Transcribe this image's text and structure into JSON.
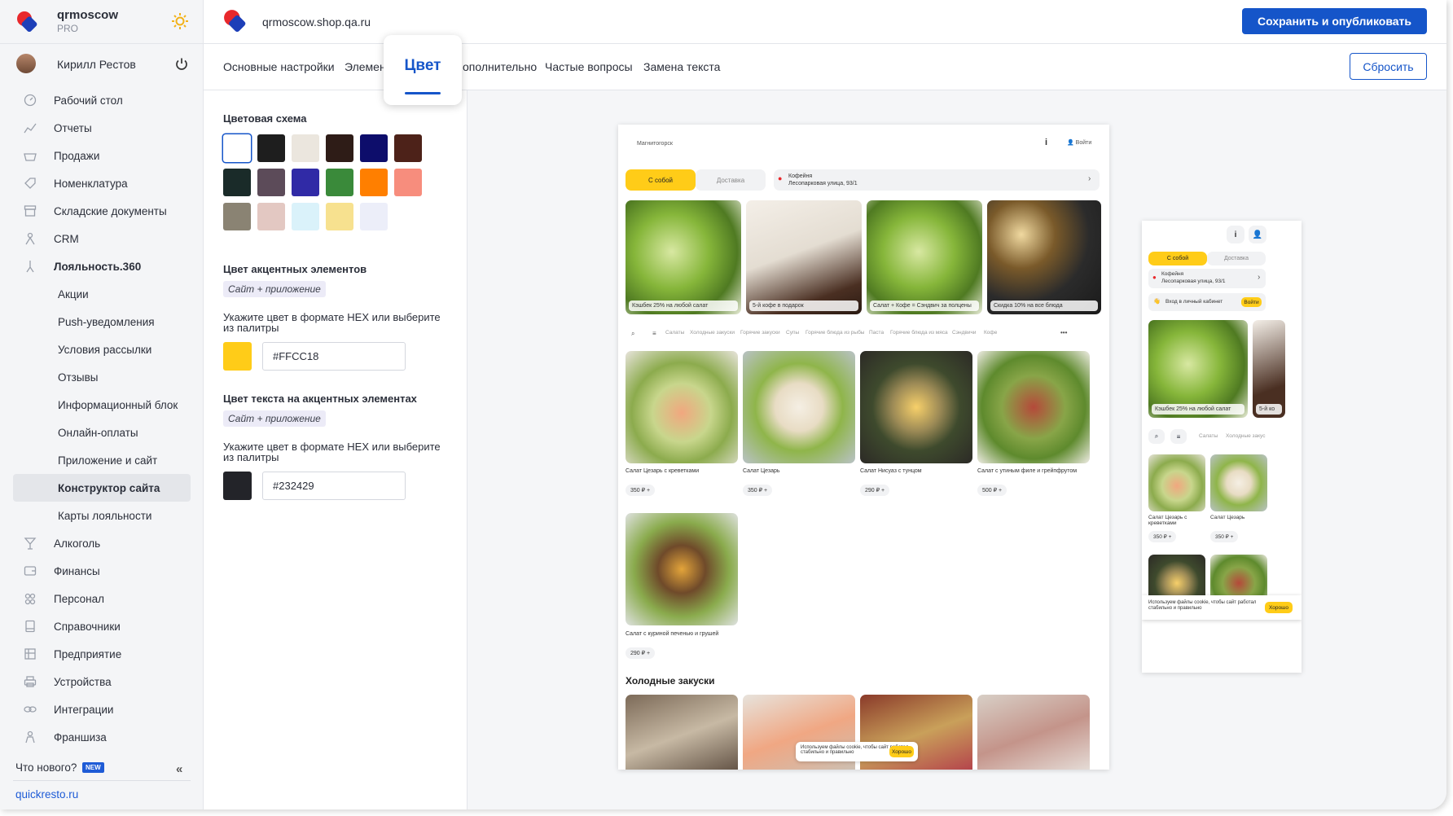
{
  "brand": {
    "name": "qrmoscow",
    "plan": "PRO"
  },
  "user": {
    "name": "Кирилл Рестов"
  },
  "sidebar": {
    "items": [
      {
        "label": "Рабочий стол",
        "icon": "dashboard-icon"
      },
      {
        "label": "Отчеты",
        "icon": "chart-icon"
      },
      {
        "label": "Продажи",
        "icon": "basket-icon"
      },
      {
        "label": "Номенклатура",
        "icon": "tag-icon"
      },
      {
        "label": "Складские документы",
        "icon": "warehouse-icon"
      },
      {
        "label": "CRM",
        "icon": "crm-icon"
      },
      {
        "label": "Лояльность.360",
        "icon": "loyalty-icon"
      },
      {
        "label": "Акции"
      },
      {
        "label": "Push-уведомления"
      },
      {
        "label": "Условия рассылки"
      },
      {
        "label": "Отзывы"
      },
      {
        "label": "Информационный блок"
      },
      {
        "label": "Онлайн-оплаты"
      },
      {
        "label": "Приложение и сайт"
      },
      {
        "label": "Конструктор сайта"
      },
      {
        "label": "Карты лояльности"
      },
      {
        "label": "Алкоголь",
        "icon": "glass-icon"
      },
      {
        "label": "Финансы",
        "icon": "wallet-icon"
      },
      {
        "label": "Персонал",
        "icon": "people-icon"
      },
      {
        "label": "Справочники",
        "icon": "book-icon"
      },
      {
        "label": "Предприятие",
        "icon": "building-icon"
      },
      {
        "label": "Устройства",
        "icon": "printer-icon"
      },
      {
        "label": "Интеграции",
        "icon": "link-icon"
      },
      {
        "label": "Франшиза",
        "icon": "franchise-icon"
      }
    ],
    "whats_new": "Что нового?",
    "new_badge": "NEW",
    "site_link": "quickresto.ru"
  },
  "header": {
    "url": "qrmoscow.shop.qa.ru",
    "publish_label": "Сохранить и опубликовать",
    "reset_label": "Сбросить"
  },
  "tabs": {
    "main": "Основные настройки",
    "elements": "Элемен",
    "color": "Цвет",
    "extra": "ополнительно",
    "faq": "Частые вопросы",
    "text": "Замена текста"
  },
  "settings": {
    "scheme_title": "Цветовая схема",
    "swatch_colors": [
      "#ffffff",
      "#1e1e1e",
      "#ebe6de",
      "#2e1c17",
      "#0d0d6b",
      "#4d2219",
      "#1a2b29",
      "#5c4b59",
      "#302aa6",
      "#3a8a3a",
      "#ff7f00",
      "#f78d7d",
      "#8a8373",
      "#e3c8c2",
      "#daf2fa",
      "#f7e18f",
      "#eceef9"
    ],
    "accent_title": "Цвет акцентных элементов",
    "accent_chip": "Сайт + приложение",
    "accent_hint": "Укажите цвет в формате HEX или выберите из палитры",
    "accent_hex": "#FFCC18",
    "text_title": "Цвет текста на акцентных элементах",
    "text_chip": "Сайт + приложение",
    "text_hint": "Укажите цвет в формате HEX или выберите из палитры",
    "text_hex": "#232429"
  },
  "preview": {
    "city": "Магнитогорск",
    "login": "Войти",
    "takeaway": "С собой",
    "delivery": "Доставка",
    "place_name": "Кофейня",
    "place_addr": "Лесопарковая улица, 93/1",
    "promos": [
      "Кэшбек 25% на любой салат",
      "5-й кофе в подарок",
      "Салат + Кофе = Сэндвич за полцены",
      "Скидка 10% на все блюда"
    ],
    "categories": [
      "Салаты",
      "Холодные закуски",
      "Горячие закуски",
      "Супы",
      "Горячие блюда из рыбы",
      "Паста",
      "Горячие блюда из мяса",
      "Сэндвичи",
      "Кофе"
    ],
    "products": [
      {
        "name": "Салат Цезарь с креветками",
        "price": "350 ₽"
      },
      {
        "name": "Салат Цезарь",
        "price": "350 ₽"
      },
      {
        "name": "Салат Нисуаз с тунцом",
        "price": "290 ₽"
      },
      {
        "name": "Салат с утиным филе и грейпфрутом",
        "price": "500 ₽"
      },
      {
        "name": "Салат с куриной печенью и грушей",
        "price": "290 ₽"
      }
    ],
    "section2": "Холодные закуски",
    "cookie_text": "Используем файлы cookie, чтобы сайт работал стабильно и правильно",
    "cookie_ok": "Хорошо",
    "mobile_cabinet": "Вход в личный кабинет",
    "mobile_login": "Войти",
    "mobile_promo2": "5-й ко",
    "mobile_cat_partial": "Холодные закус",
    "mobile_product1": "Салат Цезарь с креветками"
  }
}
